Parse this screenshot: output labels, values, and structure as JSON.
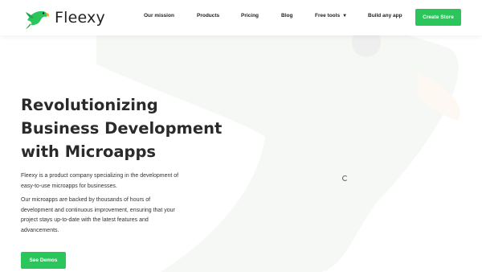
{
  "brand": {
    "name": "Fleexy",
    "logo_icon": "parrot-icon"
  },
  "nav": {
    "items": [
      {
        "label": "Our mission"
      },
      {
        "label": "Products"
      },
      {
        "label": "Pricing"
      },
      {
        "label": "Blog"
      },
      {
        "label": "Free tools",
        "dropdown": true
      },
      {
        "label": "Build any app"
      }
    ],
    "cta_label": "Create Store"
  },
  "hero": {
    "title_lines": [
      "Revolutionizing",
      "Business Development",
      "with Microapps"
    ],
    "paragraph1": "Fleexy is a product company specializing in the development of easy-to-use microapps for businesses.",
    "paragraph2": "Our microapps are backed by thousands of hours of development and continuous improvement, ensuring that your project stays up-to-date with the latest features and advancements.",
    "cta_label": "See Demos"
  },
  "colors": {
    "accent": "#2ac55b",
    "background_shape": "#f6f8f5",
    "circle": "#efefef"
  }
}
